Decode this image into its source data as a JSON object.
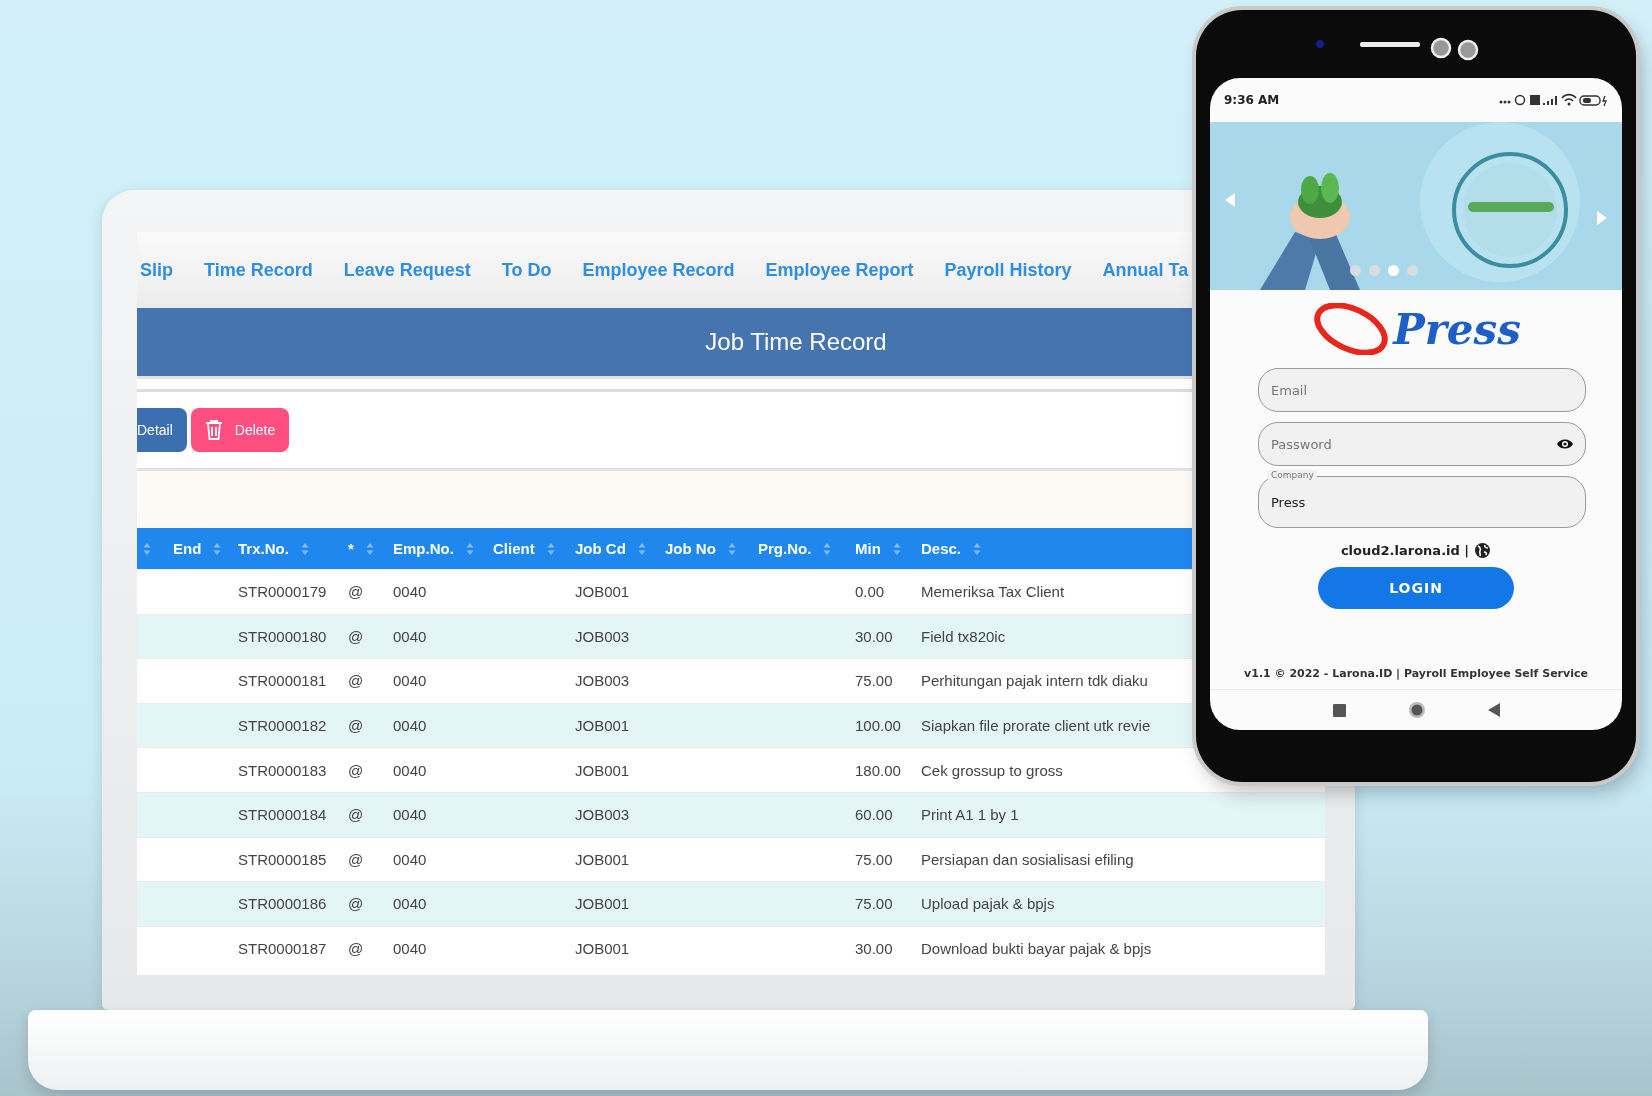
{
  "laptop": {
    "nav_tabs": [
      {
        "label": "Slip"
      },
      {
        "label": "Time Record"
      },
      {
        "label": "Leave Request"
      },
      {
        "label": "To Do"
      },
      {
        "label": "Employee Record"
      },
      {
        "label": "Employee Report"
      },
      {
        "label": "Payroll History"
      },
      {
        "label": "Annual Ta"
      }
    ],
    "page_title": "Job Time Record",
    "toolbar_buttons": [
      {
        "label": "Detail",
        "kind": "detail"
      },
      {
        "label": "Delete",
        "kind": "delete"
      }
    ],
    "table": {
      "columns": [
        "End",
        "Trx.No.",
        "*",
        "Emp.No.",
        "Client",
        "Job Cd",
        "Job No",
        "Prg.No.",
        "Min",
        "Desc."
      ],
      "rows": [
        {
          "trx_no": "STR0000179",
          "flag": "@",
          "emp_no": "0040",
          "job_cd": "JOB001",
          "min": "0.00",
          "desc": "Memeriksa Tax Client"
        },
        {
          "trx_no": "STR0000180",
          "flag": "@",
          "emp_no": "0040",
          "job_cd": "JOB003",
          "min": "30.00",
          "desc": "Field tx820ic"
        },
        {
          "trx_no": "STR0000181",
          "flag": "@",
          "emp_no": "0040",
          "job_cd": "JOB003",
          "min": "75.00",
          "desc": "Perhitungan pajak intern tdk diaku"
        },
        {
          "trx_no": "STR0000182",
          "flag": "@",
          "emp_no": "0040",
          "job_cd": "JOB001",
          "min": "100.00",
          "desc": "Siapkan file prorate client utk revie"
        },
        {
          "trx_no": "STR0000183",
          "flag": "@",
          "emp_no": "0040",
          "job_cd": "JOB001",
          "min": "180.00",
          "desc": "Cek grossup to gross"
        },
        {
          "trx_no": "STR0000184",
          "flag": "@",
          "emp_no": "0040",
          "job_cd": "JOB003",
          "min": "60.00",
          "desc": "Print A1 1 by 1"
        },
        {
          "trx_no": "STR0000185",
          "flag": "@",
          "emp_no": "0040",
          "job_cd": "JOB001",
          "min": "75.00",
          "desc": "Persiapan dan sosialisasi efiling"
        },
        {
          "trx_no": "STR0000186",
          "flag": "@",
          "emp_no": "0040",
          "job_cd": "JOB001",
          "min": "75.00",
          "desc": "Upload pajak & bpjs"
        },
        {
          "trx_no": "STR0000187",
          "flag": "@",
          "emp_no": "0040",
          "job_cd": "JOB001",
          "min": "30.00",
          "desc": "Download bukti bayar pajak & bpjs"
        }
      ]
    }
  },
  "phone": {
    "time": "9:36 AM",
    "carousel_dots": [
      {
        "selected": false
      },
      {
        "selected": false
      },
      {
        "selected": true
      },
      {
        "selected": false
      }
    ],
    "logo": "Press",
    "fields": [
      {
        "kind": "email",
        "placeholder": "Email"
      },
      {
        "kind": "password",
        "placeholder": "Password"
      },
      {
        "kind": "company",
        "label": "Company",
        "value": "Press"
      }
    ],
    "server": "cloud2.larona.id |",
    "login_button": "LOGIN",
    "footer": "v1.1 © 2022 - Larona.ID | Payroll Employee Self Service"
  }
}
